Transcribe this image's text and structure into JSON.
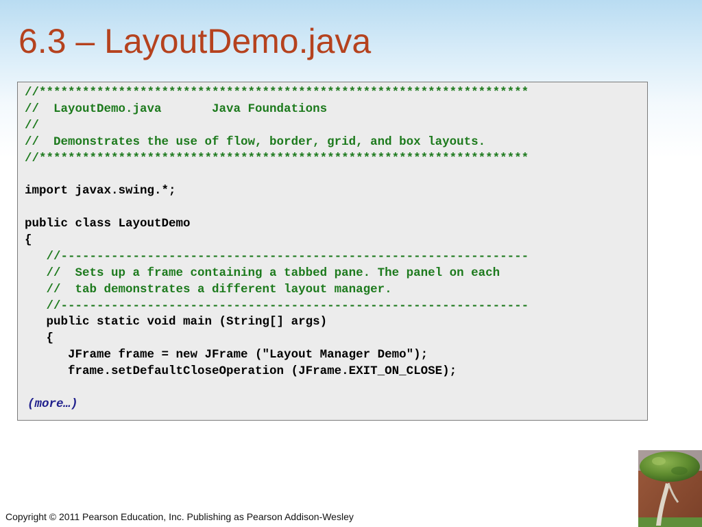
{
  "slide": {
    "title": "6.3 – LayoutDemo.java",
    "footer": "Copyright © 2011 Pearson Education, Inc. Publishing as Pearson Addison-Wesley"
  },
  "code": {
    "lines": [
      {
        "text": "//********************************************************************",
        "kind": "comment"
      },
      {
        "text": "//  LayoutDemo.java       Java Foundations",
        "kind": "comment"
      },
      {
        "text": "//",
        "kind": "comment"
      },
      {
        "text": "//  Demonstrates the use of flow, border, grid, and box layouts.",
        "kind": "comment"
      },
      {
        "text": "//********************************************************************",
        "kind": "comment"
      },
      {
        "text": "",
        "kind": "code"
      },
      {
        "text": "import javax.swing.*;",
        "kind": "code"
      },
      {
        "text": "",
        "kind": "code"
      },
      {
        "text": "public class LayoutDemo",
        "kind": "code"
      },
      {
        "text": "{",
        "kind": "code"
      },
      {
        "text": "   //-----------------------------------------------------------------",
        "kind": "comment"
      },
      {
        "text": "   //  Sets up a frame containing a tabbed pane. The panel on each",
        "kind": "comment"
      },
      {
        "text": "   //  tab demonstrates a different layout manager.",
        "kind": "comment"
      },
      {
        "text": "   //-----------------------------------------------------------------",
        "kind": "comment"
      },
      {
        "text": "   public static void main (String[] args)",
        "kind": "code"
      },
      {
        "text": "   {",
        "kind": "code"
      },
      {
        "text": "      JFrame frame = new JFrame (\"Layout Manager Demo\");",
        "kind": "code"
      },
      {
        "text": "      frame.setDefaultCloseOperation (JFrame.EXIT_ON_CLOSE);",
        "kind": "code"
      },
      {
        "text": "",
        "kind": "code"
      }
    ],
    "more_label": "(more…)"
  },
  "colors": {
    "title": "#b5421e",
    "comment": "#1d7a1d",
    "code": "#000000",
    "more": "#1f1f8c",
    "code_background": "#ececec"
  },
  "icons": {
    "decoration": "topiary-tree-photo"
  }
}
